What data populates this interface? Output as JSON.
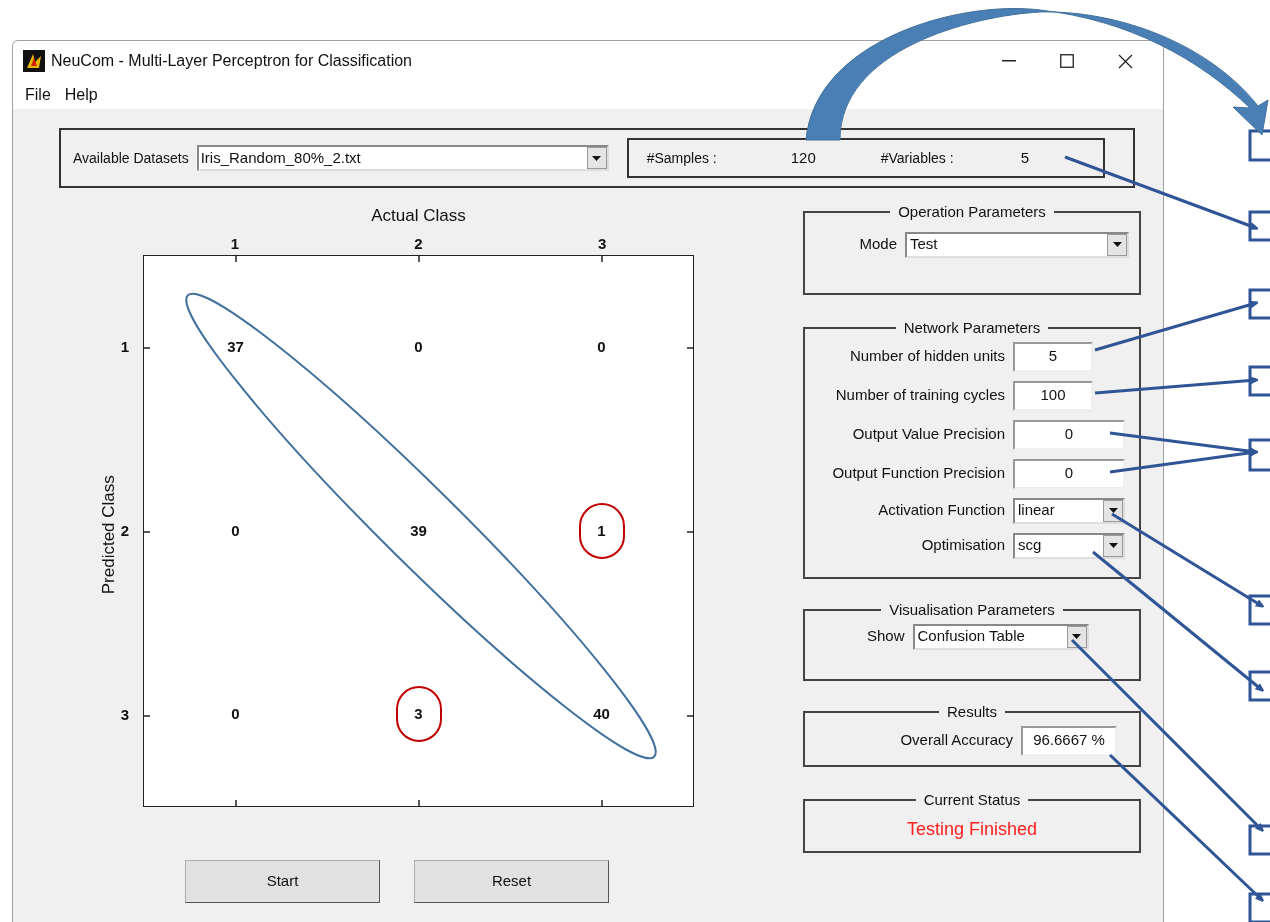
{
  "window": {
    "title": "NeuCom - Multi-Layer Perceptron for Classification",
    "menu": [
      "File",
      "Help"
    ]
  },
  "dataset": {
    "label": "Available Datasets",
    "value": "Iris_Random_80%_2.txt"
  },
  "info": [
    {
      "label": "#Samples :",
      "value": "120"
    },
    {
      "label": "#Variables :",
      "value": "5"
    }
  ],
  "matrix": {
    "title": "Actual Class",
    "ylabel": "Predicted Class",
    "columns": [
      "1",
      "2",
      "3"
    ],
    "rows": [
      {
        "label": "1",
        "cells": [
          {
            "value": "37",
            "highlighted": false
          },
          {
            "value": "0",
            "highlighted": false
          },
          {
            "value": "0",
            "highlighted": false
          }
        ]
      },
      {
        "label": "2",
        "cells": [
          {
            "value": "0",
            "highlighted": false
          },
          {
            "value": "39",
            "highlighted": false
          },
          {
            "value": "1",
            "highlighted": true
          }
        ]
      },
      {
        "label": "3",
        "cells": [
          {
            "value": "0",
            "highlighted": false
          },
          {
            "value": "3",
            "highlighted": true
          },
          {
            "value": "40",
            "highlighted": false
          }
        ]
      }
    ]
  },
  "panels": [
    {
      "title": "Operation Parameters",
      "fields": [
        {
          "kind": "dropdown",
          "label": "Mode",
          "value": "Test"
        }
      ]
    },
    {
      "title": "Network Parameters",
      "fields": [
        {
          "kind": "input",
          "label": "Number of hidden units",
          "value": "5"
        },
        {
          "kind": "input",
          "label": "Number of training cycles",
          "value": "100"
        },
        {
          "kind": "input",
          "label": "Output Value Precision",
          "value": "0"
        },
        {
          "kind": "input",
          "label": "Output Function Precision",
          "value": "0"
        },
        {
          "kind": "dropdown",
          "label": "Activation Function",
          "value": "linear"
        },
        {
          "kind": "dropdown",
          "label": "Optimisation",
          "value": "scg"
        }
      ]
    },
    {
      "title": "Visualisation Parameters",
      "fields": [
        {
          "kind": "dropdown",
          "label": "Show",
          "value": "Confusion Table"
        }
      ]
    },
    {
      "title": "Results",
      "fields": [
        {
          "kind": "input",
          "label": "Overall Accuracy",
          "value": "96.6667 %"
        }
      ]
    },
    {
      "title": "Current Status",
      "status": "Testing Finished"
    }
  ],
  "buttons": [
    "Start",
    "Reset"
  ]
}
